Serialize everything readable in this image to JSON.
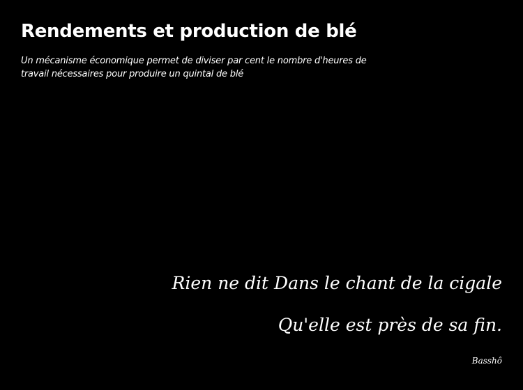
{
  "slide": {
    "title": "Rendements et production de blé",
    "subtitle": "Un mécanisme économique permet de diviser par cent le nombre d'heures de travail nécessaires pour produire un quintal de blé",
    "quote": {
      "lines": [
        "Rien ne dit Dans le chant de la cigale",
        "Qu'elle est près de sa fin."
      ],
      "author": "Basshô"
    }
  },
  "colors": {
    "background": "#000000",
    "text": "#ffffff"
  }
}
